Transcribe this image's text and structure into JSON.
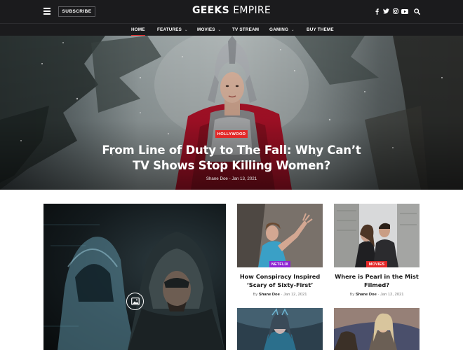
{
  "header": {
    "subscribe_label": "SUBSCRIBE",
    "logo_bold": "GEEKS",
    "logo_light": "EMPIRE",
    "social_icons": [
      "facebook-icon",
      "twitter-icon",
      "instagram-icon",
      "youtube-icon"
    ],
    "search_icon": "search-icon"
  },
  "nav": {
    "items": [
      {
        "label": "HOME",
        "active": true
      },
      {
        "label": "FEATURES",
        "dropdown": true
      },
      {
        "label": "MOVIES",
        "dropdown": true
      },
      {
        "label": "TV STREAM"
      },
      {
        "label": "GAMING",
        "dropdown": true
      },
      {
        "label": "BUY THEME"
      }
    ],
    "accent": "#e32727"
  },
  "hero": {
    "category": "HOLLYWOOD",
    "title_line1": "From Line of Duty to The Fall: Why Can’t",
    "title_line2": "TV Shows Stop Killing Women?",
    "author": "Shane Doe",
    "separator": "-",
    "date": "Jan 13, 2021"
  },
  "featured": {
    "media_icon": "image-gallery-icon"
  },
  "cards": [
    {
      "category": "NETFLIX",
      "category_color": "#8d23d2",
      "title_line1": "How Conspiracy Inspired",
      "title_line2": "‘Scary of Sixty-First’",
      "by": "By",
      "author": "Shane Doe",
      "separator": "·",
      "date": "Jan 12, 2021"
    },
    {
      "category": "MOVIES",
      "category_color": "#e32727",
      "title_line1": "Where is Pearl in the Mist",
      "title_line2": "Filmed?",
      "by": "By",
      "author": "Shane Doe",
      "separator": "·",
      "date": "Jan 12, 2021"
    }
  ],
  "colors": {
    "topbar": "#1b1b1d",
    "accent": "#e32727",
    "netflix": "#8d23d2"
  }
}
